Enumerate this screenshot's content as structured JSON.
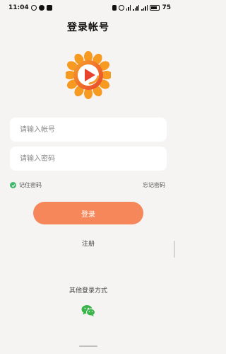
{
  "status_bar": {
    "time": "11:04",
    "battery": "75",
    "left_icons": [
      "ring-icon",
      "dot-icon",
      "message-icon"
    ],
    "right_icons": [
      "vibrate-icon",
      "alarm-icon",
      "wifi-icon",
      "signal-icon",
      "signal-icon",
      "battery-icon"
    ]
  },
  "page": {
    "title": "登录帐号"
  },
  "logo": {
    "icon": "sunflower-play-logo",
    "colors": {
      "petals": "#f79a21",
      "center": "#e8432c"
    }
  },
  "form": {
    "account_placeholder": "请输入帐号",
    "password_placeholder": "请输入密码",
    "remember_label": "记住密码",
    "forgot_label": "忘记密码",
    "remember_checked": true
  },
  "actions": {
    "login_label": "登录",
    "register_label": "注册"
  },
  "other_login": {
    "label": "其他登录方式",
    "icon": "wechat-icon"
  },
  "colors": {
    "accent": "#f6875a",
    "background": "#f5f4f2",
    "check": "#3fb86b",
    "wechat": "#3bb54a"
  }
}
